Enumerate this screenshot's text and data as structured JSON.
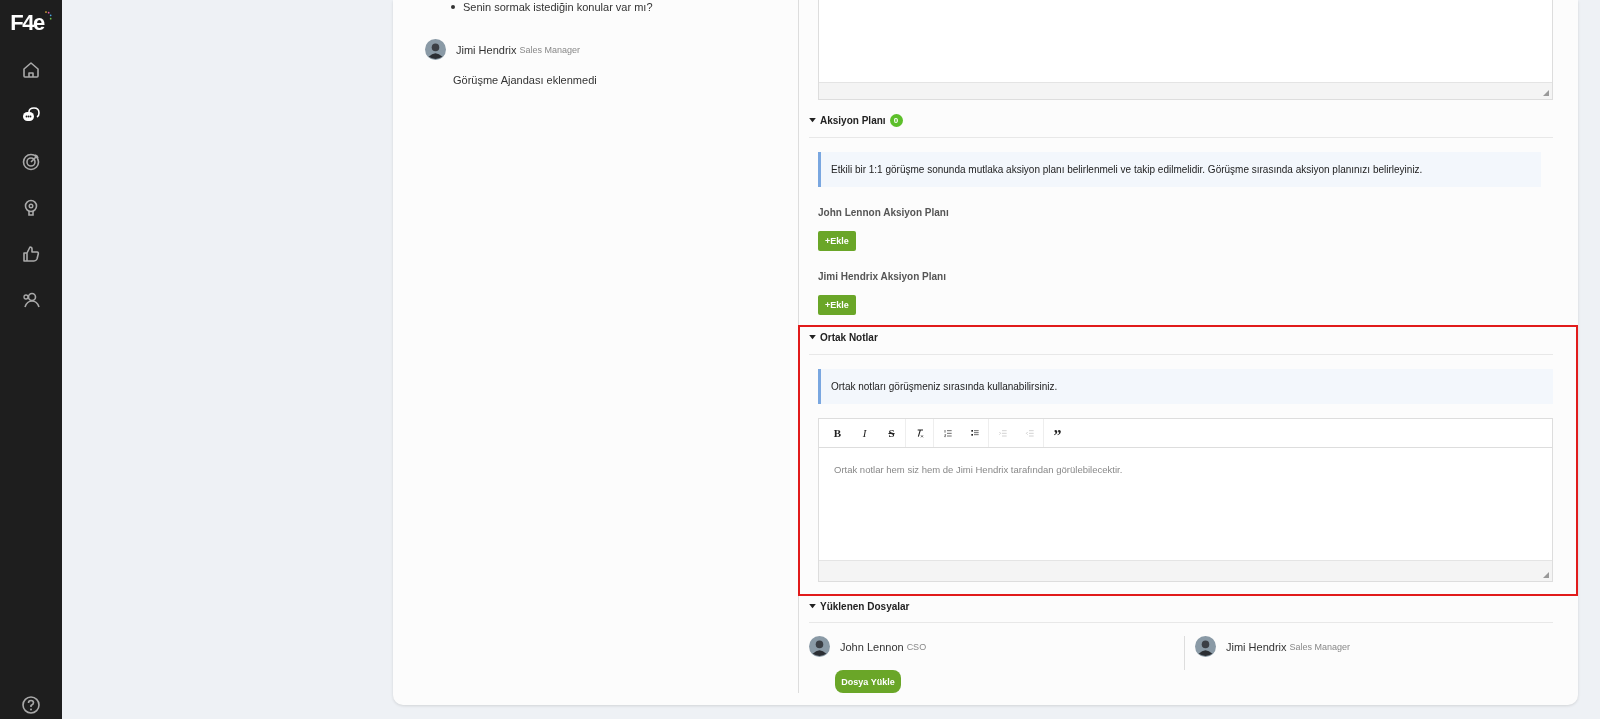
{
  "sidebar": {
    "logo": "F4e",
    "nav": [
      {
        "kind": "home",
        "selected": false
      },
      {
        "kind": "chat",
        "selected": true
      },
      {
        "kind": "target",
        "selected": false
      },
      {
        "kind": "bulb",
        "selected": false
      },
      {
        "kind": "thumb",
        "selected": false
      },
      {
        "kind": "people",
        "selected": false
      }
    ],
    "help": {
      "kind": "help"
    }
  },
  "left_panel": {
    "agenda_item": "Senin sormak istediğin konular var mı?",
    "participant": {
      "name": "Jimi Hendrix",
      "role": "Sales Manager"
    },
    "agenda_status": "Görüşme Ajandası eklenmedi"
  },
  "sections": [
    {
      "kind": "action_plan",
      "title": "Aksiyon Planı",
      "expanded": true,
      "badge": "0",
      "info": "Etkili bir 1:1 görüşme sonunda mutlaka aksiyon planı belirlenmeli ve takip edilmelidir. Görüşme sırasında aksiyon planınızı belirleyiniz.",
      "plans": [
        {
          "label": "John Lennon Aksiyon Planı",
          "button": "+Ekle"
        },
        {
          "label": "Jimi Hendrix Aksiyon Planı",
          "button": "+Ekle"
        }
      ]
    },
    {
      "kind": "notes",
      "title": "Ortak Notlar",
      "expanded": true,
      "highlighted": true,
      "info": "Ortak notları görüşmeniz sırasında kullanabilirsiniz.",
      "editor": {
        "toolbar": [
          {
            "kind": "bold",
            "label": "B",
            "disabled": false
          },
          {
            "kind": "italic",
            "label": "I",
            "disabled": false
          },
          {
            "kind": "strike",
            "label": "S",
            "disabled": false
          },
          {
            "kind": "clear_format",
            "disabled": false
          },
          {
            "kind": "ordered_list",
            "disabled": false
          },
          {
            "kind": "bullet_list",
            "disabled": false
          },
          {
            "kind": "outdent",
            "disabled": true
          },
          {
            "kind": "indent",
            "disabled": true
          },
          {
            "kind": "quote",
            "label": "”",
            "disabled": false
          }
        ],
        "placeholder": "Ortak notlar hem siz hem de Jimi Hendrix tarafından görülebilecektir."
      }
    },
    {
      "kind": "files",
      "title": "Yüklenen Dosyalar",
      "expanded": true,
      "uploads": [
        {
          "name": "John Lennon",
          "role": "CSO",
          "button": "Dosya Yükle"
        },
        {
          "name": "Jimi Hendrix",
          "role": "Sales Manager"
        }
      ]
    }
  ]
}
